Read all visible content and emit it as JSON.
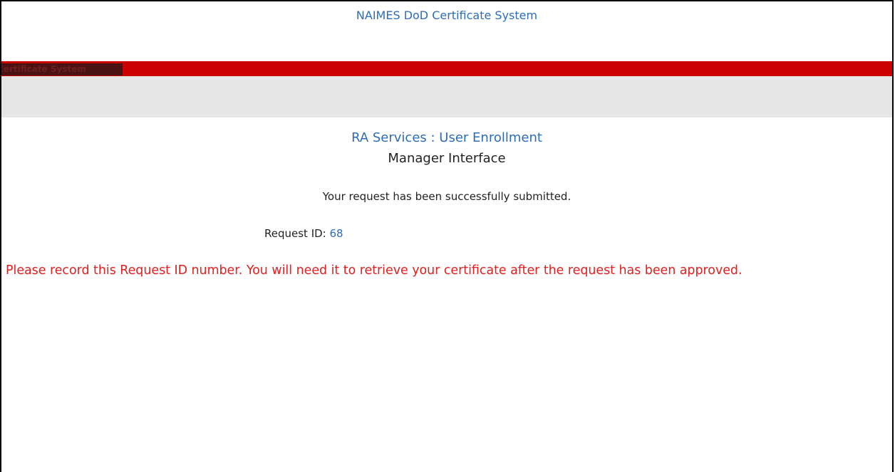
{
  "header": {
    "site_title": "NAIMES DoD Certificate System",
    "bar_label": "Certificate System"
  },
  "main": {
    "section": "RA Services",
    "separator": " : ",
    "page": "User Enrollment",
    "subtitle": "Manager Interface",
    "success_message": "Your request has been successfully submitted.",
    "request_id_label": "Request ID: ",
    "request_id_value": "68",
    "warning": "Please record this Request ID number. You will need it to retrieve your certificate after the request has been approved."
  },
  "colors": {
    "link_blue": "#2e6db4",
    "banner_red": "#cc0000",
    "warning_red": "#e02020",
    "band_gray": "#e6e6e6"
  }
}
